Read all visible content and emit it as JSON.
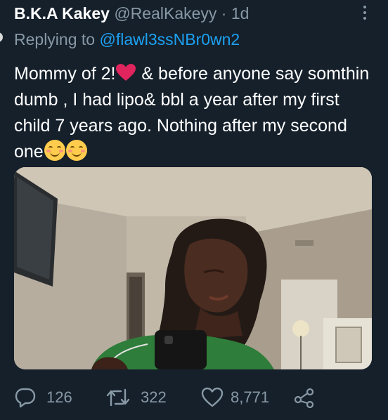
{
  "tweet": {
    "author_name": "B.K.A Kakey",
    "author_handle": "@RealKakeyy",
    "separator": "·",
    "time": "1d",
    "reply_prefix": "Replying to",
    "reply_handle": "@flawl3ssNBr0wn2",
    "text_part1": "Mommy of 2!",
    "text_part2": " & before anyone say somthin dumb , I had lipo& bbl a year after my first child 7 years ago. Nothing after my second one",
    "heart_emoji": "heart-emoji",
    "smile_emoji": "smiling-face-emoji"
  },
  "media": {
    "type": "photo"
  },
  "actions": {
    "replies": "126",
    "retweets": "322",
    "likes": "8,771"
  },
  "colors": {
    "background": "#15202b",
    "primary_text": "#ffffff",
    "secondary_text": "#8899a6",
    "link": "#1da1f2",
    "heart": "#e0245e"
  }
}
